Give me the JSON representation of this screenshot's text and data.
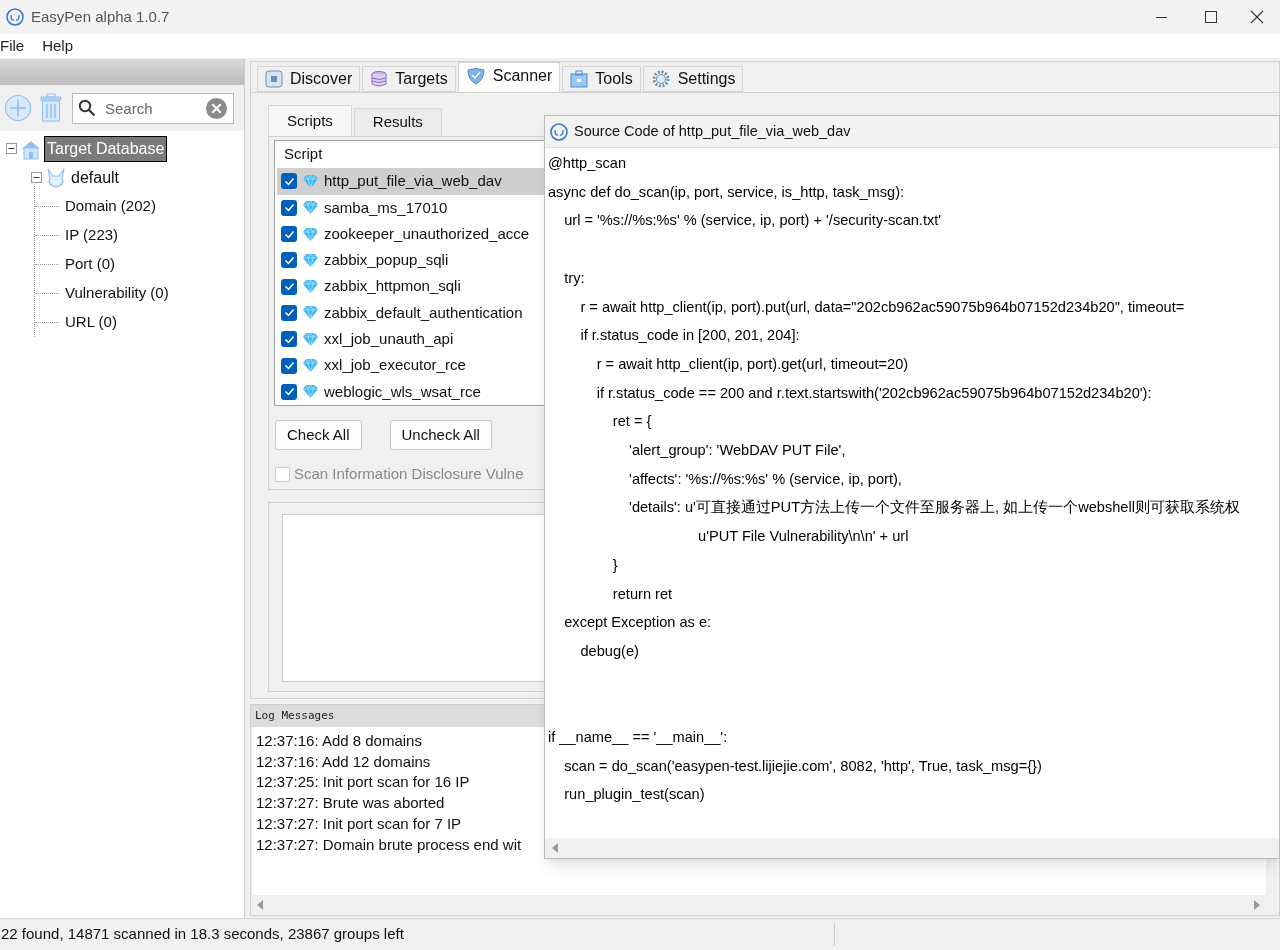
{
  "window": {
    "title": "EasyPen alpha 1.0.7"
  },
  "menu": [
    "File",
    "Help"
  ],
  "sidebar": {
    "search": {
      "placeholder": "Search"
    },
    "tree": [
      {
        "label": "Target Database",
        "selected": true,
        "expanded": true,
        "children": [
          {
            "label": "default",
            "selected": false,
            "expanded": true,
            "children": [
              {
                "label": "Domain (202)",
                "selected": false
              },
              {
                "label": "IP (223)",
                "selected": false
              },
              {
                "label": "Port (0)",
                "selected": false
              },
              {
                "label": "Vulnerability (0)",
                "selected": false
              },
              {
                "label": "URL (0)",
                "selected": false
              }
            ]
          }
        ]
      }
    ]
  },
  "tabs": [
    {
      "label": "Discover",
      "selected": false
    },
    {
      "label": "Targets",
      "selected": false
    },
    {
      "label": "Scanner",
      "selected": true
    },
    {
      "label": "Tools",
      "selected": false
    },
    {
      "label": "Settings",
      "selected": false
    }
  ],
  "scanner": {
    "subtabs": [
      {
        "label": "Scripts",
        "selected": true
      },
      {
        "label": "Results",
        "selected": false
      }
    ],
    "script_list": {
      "column": "Script",
      "rows": [
        {
          "name": "http_put_file_via_web_dav",
          "checked": true,
          "selected": true
        },
        {
          "name": "samba_ms_17010",
          "checked": true,
          "selected": false
        },
        {
          "name": "zookeeper_unauthorized_acce",
          "checked": true,
          "selected": false
        },
        {
          "name": "zabbix_popup_sqli",
          "checked": true,
          "selected": false
        },
        {
          "name": "zabbix_httpmon_sqli",
          "checked": true,
          "selected": false
        },
        {
          "name": "zabbix_default_authentication",
          "checked": true,
          "selected": false
        },
        {
          "name": "xxl_job_unauth_api",
          "checked": true,
          "selected": false
        },
        {
          "name": "xxl_job_executor_rce",
          "checked": true,
          "selected": false
        },
        {
          "name": "weblogic_wls_wsat_rce",
          "checked": true,
          "selected": false
        }
      ]
    },
    "buttons": [
      "Check All",
      "Uncheck All"
    ],
    "disclosure_option": {
      "label": "Scan Information Disclosure Vulne",
      "checked": false
    }
  },
  "log": {
    "title": "Log Messages",
    "lines": [
      "12:37:16: Add 8 domains",
      "12:37:16: Add 12 domains",
      "12:37:25: Init port scan for 16 IP",
      "12:37:27: Brute was aborted",
      "12:37:27: Init port scan for 7 IP",
      "12:37:27: Domain brute process end wit"
    ]
  },
  "status_bar": "22 found, 14871 scanned in 18.3 seconds, 23867 groups left",
  "source_dialog": {
    "title": "Source Code of http_put_file_via_web_dav",
    "code": "@http_scan\nasync def do_scan(ip, port, service, is_http, task_msg):\n    url = '%s://%s:%s' % (service, ip, port) + '/security-scan.txt'\n\n    try:\n        r = await http_client(ip, port).put(url, data=\"202cb962ac59075b964b07152d234b20\", timeout=\n        if r.status_code in [200, 201, 204]:\n            r = await http_client(ip, port).get(url, timeout=20)\n            if r.status_code == 200 and r.text.startswith('202cb962ac59075b964b07152d234b20'):\n                ret = {\n                    'alert_group': 'WebDAV PUT File',\n                    'affects': '%s://%s:%s' % (service, ip, port),\n                    'details': u'可直接通过PUT方法上传一个文件至服务器上, 如上传一个webshell则可获取系统权\n                                     u'PUT File Vulnerability\\n\\n' + url\n                }\n                return ret\n    except Exception as e:\n        debug(e)\n\n\nif __name__ == '__main__':\n    scan = do_scan('easypen-test.lijiejie.com', 8082, 'http', True, task_msg={})\n    run_plugin_test(scan)"
  }
}
